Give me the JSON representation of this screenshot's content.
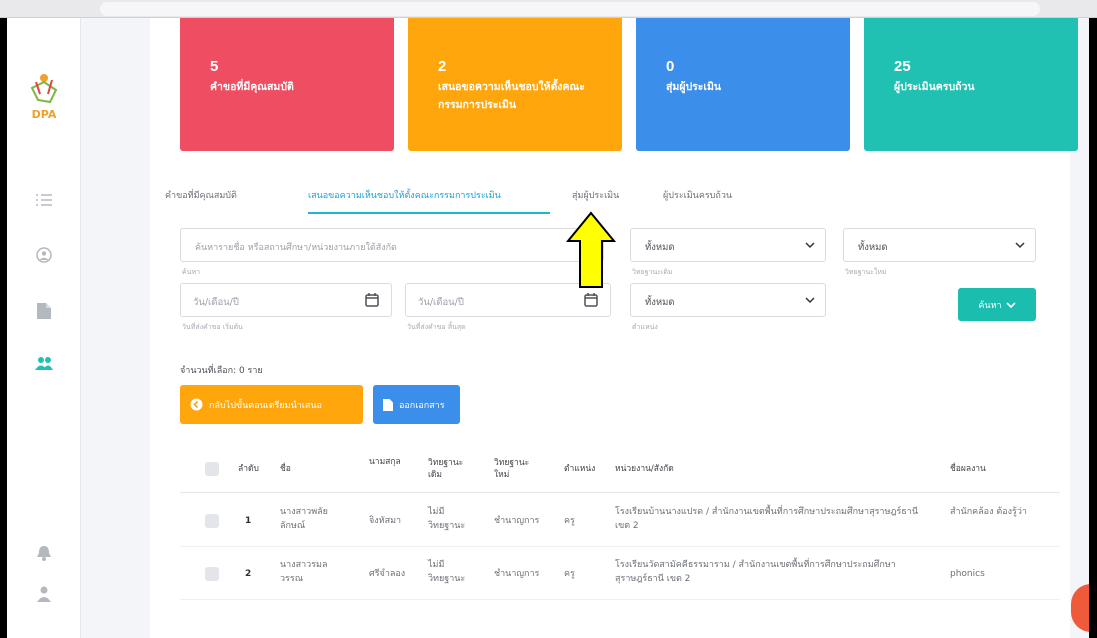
{
  "cards": [
    {
      "count": "5",
      "label": "คำขอที่มีคุณสมบัติ",
      "color": "#ee4d62"
    },
    {
      "count": "2",
      "label": "เสนอขอความเห็นชอบให้ตั้งคณะกรรมการประเมิน",
      "color": "#ffa60d"
    },
    {
      "count": "0",
      "label": "สุ่มผู้ประเมิน",
      "color": "#3b8ee9"
    },
    {
      "count": "25",
      "label": "ผู้ประเมินครบถ้วน",
      "color": "#20c1b2"
    }
  ],
  "tabs": [
    {
      "label": "คำขอที่มีคุณสมบัติ"
    },
    {
      "label": "เสนอขอความเห็นชอบให้ตั้งคณะกรรมการประเมิน"
    },
    {
      "label": "สุ่มผู้ประเมิน"
    },
    {
      "label": "ผู้ประเมินครบถ้วน"
    }
  ],
  "filters": {
    "search_placeholder": "ค้นหารายชื่อ หรือสถานศึกษา/หน่วยงานภายใต้สังกัด",
    "search_hint": "ค้นหา",
    "old_status": {
      "value": "ทั้งหมด",
      "hint": "วิทยฐานะเดิม"
    },
    "new_status": {
      "value": "ทั้งหมด",
      "hint": "วิทยฐานะใหม่"
    },
    "date_start": {
      "placeholder": "วัน/เดือน/ปี",
      "hint": "วันที่ส่งคำขอ เริ่มต้น"
    },
    "date_end": {
      "placeholder": "วัน/เดือน/ปี",
      "hint": "วันที่ส่งคำขอ สิ้นสุด"
    },
    "position": {
      "value": "ทั้งหมด",
      "hint": "ตำแหน่ง"
    },
    "search_button": "ค้นหา"
  },
  "selected_count": "จำนวนที่เลือก: 0 ราย",
  "buttons": {
    "back": "กลับไปขั้นตอนเตรียมนำเสนอ",
    "document": "ออกเอกสาร"
  },
  "table": {
    "headers": [
      "ลำดับ",
      "ชื่อ",
      "นามสกุล",
      "วิทยฐานะเดิม",
      "วิทยฐานะใหม่",
      "ตำแหน่ง",
      "หน่วยงาน/สังกัด",
      "ชื่อผลงาน"
    ],
    "rows": [
      {
        "index": "1",
        "name": "นางสาวพลัย ลักษณ์",
        "surname": "จิงหัสมา",
        "old": "ไม่มี วิทยฐานะ",
        "new": "ชำนาญการ",
        "position": "ครู",
        "org": "โรงเรียนบ้านนางแปรด / สำนักงานเขตพื้นที่การศึกษาประถมศึกษาสุราษฎร์ธานี เขต 2",
        "work": "สำนักคล้อง ต้องรู้ว่า"
      },
      {
        "index": "2",
        "name": "นางสาวรมล วรรณ",
        "surname": "ศรีจำลอง",
        "old": "ไม่มี วิทยฐานะ",
        "new": "ชำนาญการ",
        "position": "ครู",
        "org": "โรงเรียนวัดสามัคคีธรรมาราม / สำนักงานเขตพื้นที่การศึกษาประถมศึกษาสุราษฎร์ธานี เขต 2",
        "work": "phonics"
      }
    ]
  },
  "logo_text": "DPA"
}
